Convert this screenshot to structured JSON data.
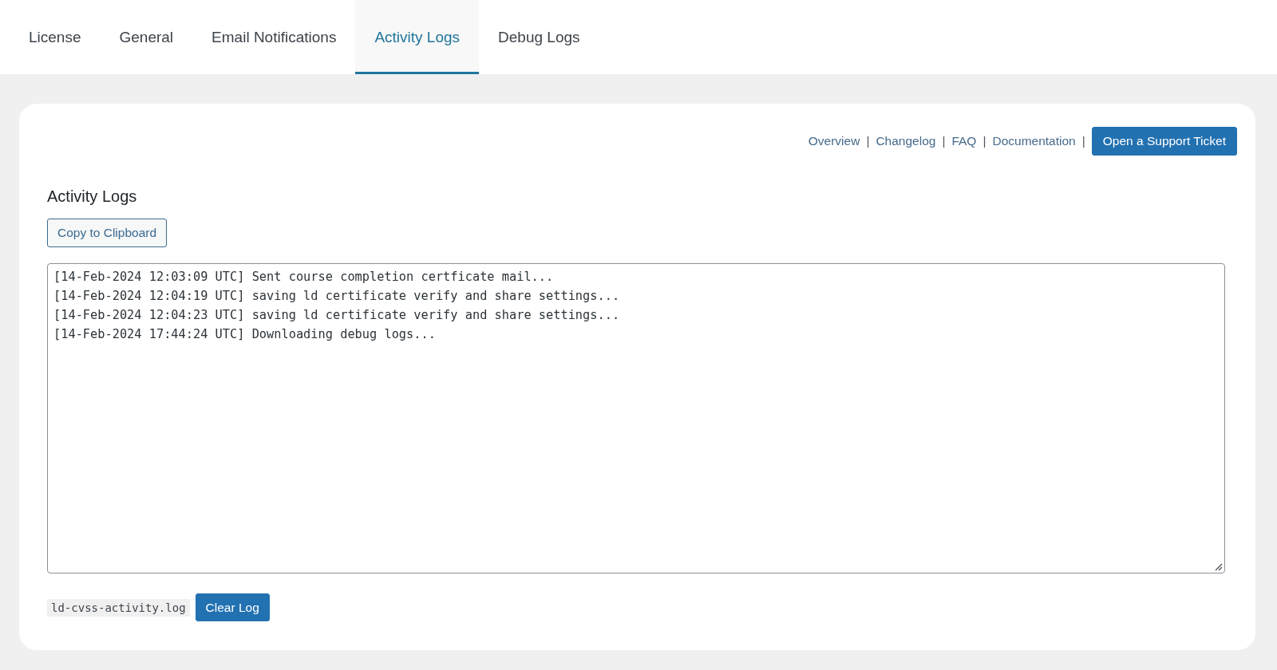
{
  "tabs": [
    {
      "label": "License",
      "selected": false
    },
    {
      "label": "General",
      "selected": false
    },
    {
      "label": "Email Notifications",
      "selected": false
    },
    {
      "label": "Activity Logs",
      "selected": true
    },
    {
      "label": "Debug Logs",
      "selected": false
    }
  ],
  "help_links": [
    {
      "label": "Overview",
      "separator": "|"
    },
    {
      "label": "Changelog",
      "separator": "|"
    },
    {
      "label": "FAQ",
      "separator": "|"
    },
    {
      "label": "Documentation",
      "separator": "|"
    }
  ],
  "support_button": "Open a Support Ticket",
  "section": {
    "title": "Activity Logs",
    "copy_button": "Copy to Clipboard",
    "log_lines": [
      "[14-Feb-2024 12:03:09 UTC] Sent course completion certficate mail...",
      "[14-Feb-2024 12:04:19 UTC] saving ld certificate verify and share settings...",
      "[14-Feb-2024 12:04:23 UTC] saving ld certificate verify and share settings...",
      "[14-Feb-2024 17:44:24 UTC] Downloading debug logs..."
    ],
    "file_name": "ld-cvss-activity.log",
    "clear_button": "Clear Log"
  }
}
